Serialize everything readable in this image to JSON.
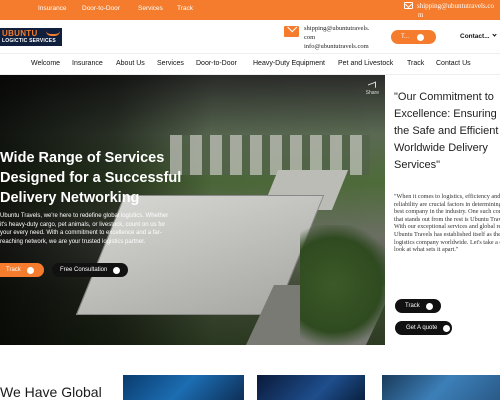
{
  "topbar": {
    "nav": [
      "Insurance",
      "Door-to-Door",
      "Services",
      "Track"
    ],
    "email_line1": "shipping@ubuntutravels.co",
    "email_line2": "m"
  },
  "header": {
    "logo_line1": "UBUNTU",
    "logo_line2": "LOGICTIC SERVICES",
    "email_line1": "shipping@ubuntutravels.",
    "email_line2": "com",
    "email_line3": "info@ubuntutravels.com",
    "track_label": "T...",
    "contact_label": "Contact..."
  },
  "nav": {
    "items": [
      "Welcome",
      "Insurance",
      "About Us",
      "Services",
      "Door-to-Door",
      "Heavy-Duty Equipment",
      "Pet and Livestock",
      "Track",
      "Contact Us"
    ]
  },
  "hero": {
    "title": "Wide Range of Services Designed for a Successful Delivery Networking",
    "description": "Ubuntu Travels, we're here to redefine global logistics. Whether it's heavy-duty cargo, pet animals, or livestock, count on us for your every need. With a commitment to excellence and a far-reaching network, we are your trusted logistics partner.",
    "track_button": "Track",
    "consult_button": "Free Consultation",
    "share_label": "Share"
  },
  "side": {
    "title": "\"Our Commitment to Excellence: Ensuring the Safe and Efficient Worldwide Delivery Services\"",
    "body": "\"When it comes to logistics, efficiency and reliability are crucial factors in determining the best company in the industry. One such company that stands out from the rest is Ubuntu Travels. With our exceptional services and global reach, Ubuntu Travels has established itself as the best logistics company worldwide. Let's take a closer look at what sets it apart.\"",
    "track_button": "Track",
    "quote_button": "Get A quote"
  },
  "bottom": {
    "heading": "We Have Global"
  },
  "colors": {
    "accent": "#f47c2c",
    "dark": "#111111",
    "logo_bg": "#0f1f3d"
  }
}
